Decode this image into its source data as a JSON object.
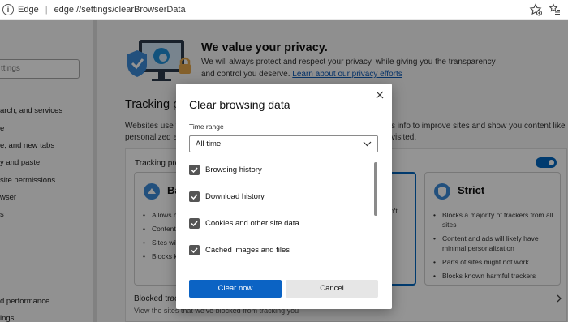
{
  "browser": {
    "brand": "Edge",
    "url_prefix": "edge://",
    "url_path": "settings/clearBrowserData"
  },
  "sidebar": {
    "search_placeholder": "ttings",
    "items": [
      "arch, and services",
      "e",
      "e, and new tabs",
      "y and paste",
      "site permissions",
      "wser",
      "s",
      "d performance",
      "ings"
    ]
  },
  "privacy": {
    "title": "We value your privacy.",
    "text": "We will always protect and respect your privacy, while giving you the transparency and control you deserve.",
    "link": "Learn about our privacy efforts"
  },
  "tracking": {
    "title_visible": "Tracking p",
    "desc_left_1": "Websites use tr",
    "desc_left_2": "personalized a",
    "desc_right_1": "s info to improve sites and show you content like",
    "desc_right_2": "visited.",
    "box_header": "Tracking pre",
    "cards": {
      "basic": {
        "title": "Ba",
        "items": [
          "Allows m",
          "Content a personal",
          "Sites will",
          "Blocks kn"
        ]
      },
      "balanced": {
        "items": [
          "ven't"
        ]
      },
      "strict": {
        "title": "Strict",
        "items": [
          "Blocks a majority of trackers from all sites",
          "Content and ads will likely have minimal personalization",
          "Parts of sites might not work",
          "Blocks known harmful trackers"
        ]
      }
    },
    "blocked_title": "Blocked trac",
    "blocked_sub": "View the sites that we've blocked from tracking you"
  },
  "dialog": {
    "title": "Clear browsing data",
    "time_range_label": "Time range",
    "time_range_value": "All time",
    "options": [
      {
        "label": "Browsing history",
        "checked": true
      },
      {
        "label": "Download history",
        "checked": true
      },
      {
        "label": "Cookies and other site data",
        "checked": true
      },
      {
        "label": "Cached images and files",
        "checked": true
      }
    ],
    "clear_label": "Clear now",
    "cancel_label": "Cancel"
  },
  "colors": {
    "accent": "#0067c0",
    "overlay": "rgba(0,0,0,0.42)",
    "checkbox": "#555555"
  }
}
